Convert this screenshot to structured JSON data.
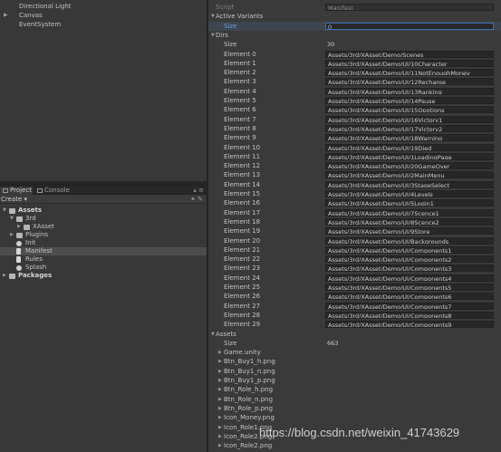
{
  "hierarchy": {
    "items": [
      {
        "label": "Directional Light",
        "expandable": false
      },
      {
        "label": "Canvas",
        "expandable": true
      },
      {
        "label": "EventSystem",
        "expandable": false
      }
    ]
  },
  "project_panel": {
    "tabs": {
      "project": "Project",
      "console": "Console"
    },
    "create_label": "Create ▾",
    "menu_glyph": "▴ ≡",
    "toolbar_icons": "✦ ✎",
    "tree": [
      {
        "label": "Assets",
        "indent": 0,
        "bold": true,
        "expanded": true,
        "icon": "folder-icon"
      },
      {
        "label": "3rd",
        "indent": 1,
        "expanded": true,
        "icon": "folder-icon"
      },
      {
        "label": "XAsset",
        "indent": 2,
        "expanded": false,
        "icon": "folder-icon"
      },
      {
        "label": "Plugins",
        "indent": 1,
        "expanded": false,
        "icon": "folder-icon"
      },
      {
        "label": "Init",
        "indent": 1,
        "icon": "gear-icon"
      },
      {
        "label": "Manifest",
        "indent": 1,
        "icon": "doc-icon",
        "selected": true
      },
      {
        "label": "Rules",
        "indent": 1,
        "icon": "doc-icon"
      },
      {
        "label": "Splash",
        "indent": 1,
        "icon": "gear-icon"
      },
      {
        "label": "Packages",
        "indent": 0,
        "bold": true,
        "expanded": false,
        "icon": "folder-icon"
      }
    ]
  },
  "inspector": {
    "script_label": "Script",
    "script_value": "Manifest",
    "active_variants": {
      "label": "Active Variants",
      "size_label": "Size",
      "size_value": "0"
    },
    "dirs": {
      "label": "Dirs",
      "size_label": "Size",
      "size_value": "30",
      "elements": [
        {
          "label": "Element 0",
          "value": "Assets/3rd/XAsset/Demo/Scenes"
        },
        {
          "label": "Element 1",
          "value": "Assets/3rd/XAsset/Demo/UI/10Character"
        },
        {
          "label": "Element 2",
          "value": "Assets/3rd/XAsset/Demo/UI/11NotEnoughMoney"
        },
        {
          "label": "Element 3",
          "value": "Assets/3rd/XAsset/Demo/UI/12Recharge"
        },
        {
          "label": "Element 4",
          "value": "Assets/3rd/XAsset/Demo/UI/13Ranking"
        },
        {
          "label": "Element 5",
          "value": "Assets/3rd/XAsset/Demo/UI/14Pause"
        },
        {
          "label": "Element 6",
          "value": "Assets/3rd/XAsset/Demo/UI/15Opotions"
        },
        {
          "label": "Element 7",
          "value": "Assets/3rd/XAsset/Demo/UI/16Victory1"
        },
        {
          "label": "Element 8",
          "value": "Assets/3rd/XAsset/Demo/UI/17Victory2"
        },
        {
          "label": "Element 9",
          "value": "Assets/3rd/XAsset/Demo/UI/18Warning"
        },
        {
          "label": "Element 10",
          "value": "Assets/3rd/XAsset/Demo/UI/19Died"
        },
        {
          "label": "Element 11",
          "value": "Assets/3rd/XAsset/Demo/UI/1LoadingPage"
        },
        {
          "label": "Element 12",
          "value": "Assets/3rd/XAsset/Demo/UI/20GameOver"
        },
        {
          "label": "Element 13",
          "value": "Assets/3rd/XAsset/Demo/UI/2MainMenu"
        },
        {
          "label": "Element 14",
          "value": "Assets/3rd/XAsset/Demo/UI/3StageSelect"
        },
        {
          "label": "Element 15",
          "value": "Assets/3rd/XAsset/Demo/UI/4Levels"
        },
        {
          "label": "Element 16",
          "value": "Assets/3rd/XAsset/Demo/UI/5Login1"
        },
        {
          "label": "Element 17",
          "value": "Assets/3rd/XAsset/Demo/UI/7Scence1"
        },
        {
          "label": "Element 18",
          "value": "Assets/3rd/XAsset/Demo/UI/8Scence2"
        },
        {
          "label": "Element 19",
          "value": "Assets/3rd/XAsset/Demo/UI/9Store"
        },
        {
          "label": "Element 20",
          "value": "Assets/3rd/XAsset/Demo/UI/Backgrounds"
        },
        {
          "label": "Element 21",
          "value": "Assets/3rd/XAsset/Demo/UI/Components1"
        },
        {
          "label": "Element 22",
          "value": "Assets/3rd/XAsset/Demo/UI/Components2"
        },
        {
          "label": "Element 23",
          "value": "Assets/3rd/XAsset/Demo/UI/Components3"
        },
        {
          "label": "Element 24",
          "value": "Assets/3rd/XAsset/Demo/UI/Components4"
        },
        {
          "label": "Element 25",
          "value": "Assets/3rd/XAsset/Demo/UI/Components5"
        },
        {
          "label": "Element 26",
          "value": "Assets/3rd/XAsset/Demo/UI/Components6"
        },
        {
          "label": "Element 27",
          "value": "Assets/3rd/XAsset/Demo/UI/Components7"
        },
        {
          "label": "Element 28",
          "value": "Assets/3rd/XAsset/Demo/UI/Components8"
        },
        {
          "label": "Element 29",
          "value": "Assets/3rd/XAsset/Demo/UI/Components9"
        }
      ]
    },
    "assets": {
      "label": "Assets",
      "size_label": "Size",
      "size_value": "663",
      "items": [
        "Game.unity",
        "Btn_Buy1_h.png",
        "Btn_Buy1_n.png",
        "Btn_Buy1_p.png",
        "Btn_Role_h.png",
        "Btn_Role_n.png",
        "Btn_Role_p.png",
        "Icon_Money.png",
        "Icon_Role1.png",
        "Icon_Role2.png",
        "Icon_Role2.png"
      ]
    }
  },
  "watermark": "https://blog.csdn.net/weixin_41743629"
}
